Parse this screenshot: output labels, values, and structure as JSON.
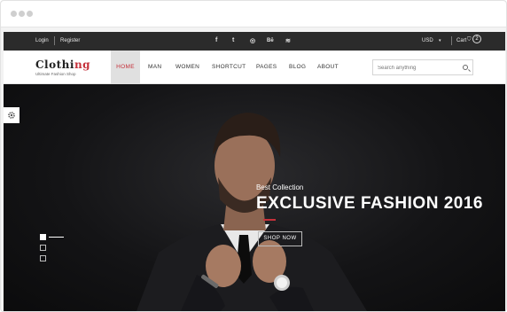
{
  "topbar": {
    "login": "Login",
    "register": "Register",
    "social": [
      "f",
      "t",
      "◎",
      "Bē",
      "≋"
    ],
    "currency": "USD",
    "cart_label": "Cart",
    "cart_count": "2"
  },
  "header": {
    "logo_main": "Clothi",
    "logo_accent": "ng",
    "tagline": "Ultimate Fashion Shop",
    "nav": [
      "HOME",
      "MAN",
      "WOMEN",
      "SHORTCUT",
      "PAGES",
      "BLOG",
      "ABOUT"
    ],
    "search_placeholder": "Search anything"
  },
  "hero": {
    "eyebrow": "Best Collection",
    "title": "EXCLUSIVE FASHION 2016",
    "button": "SHOP NOW"
  },
  "colors": {
    "accent": "#c5303a",
    "topbar": "#2b2b2b"
  }
}
